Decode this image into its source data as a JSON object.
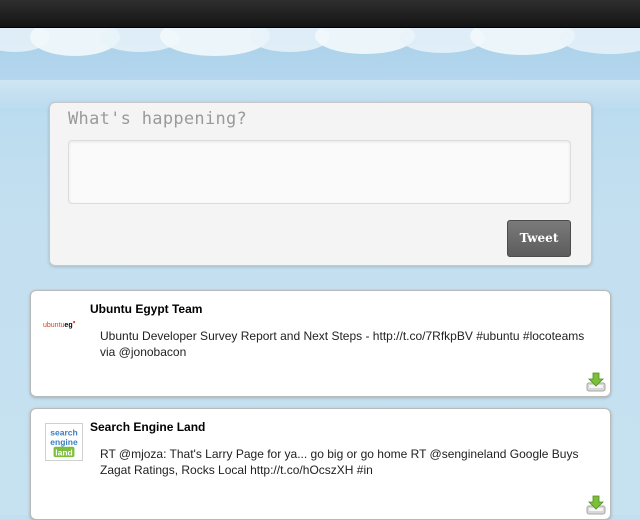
{
  "composer": {
    "prompt": "What's happening?",
    "input_value": "",
    "tweet_button_label": "Tweet"
  },
  "timeline": [
    {
      "author": "Ubuntu Egypt Team",
      "avatar_text": "ubuntueg",
      "text": "Ubuntu Developer Survey Report and Next Steps - http://t.co/7RfkpBV #ubuntu #locoteams via @jonobacon"
    },
    {
      "author": "Search Engine Land",
      "avatar_text": "search engine land",
      "text": "RT @mjoza: That's Larry Page for ya... go big or go home RT @sengineland Google Buys Zagat Ratings, Rocks Local http://t.co/hOcszXH #in"
    }
  ],
  "colors": {
    "top_bar": "#1e1e1e",
    "sky": "#c3deee",
    "tweet_button": "#666666",
    "ubuntu_orange": "#d1431c",
    "sel_blue": "#3a7fc1",
    "save_icon_green": "#7cbf3a"
  },
  "icons": {
    "save": "download-arrow-icon"
  }
}
